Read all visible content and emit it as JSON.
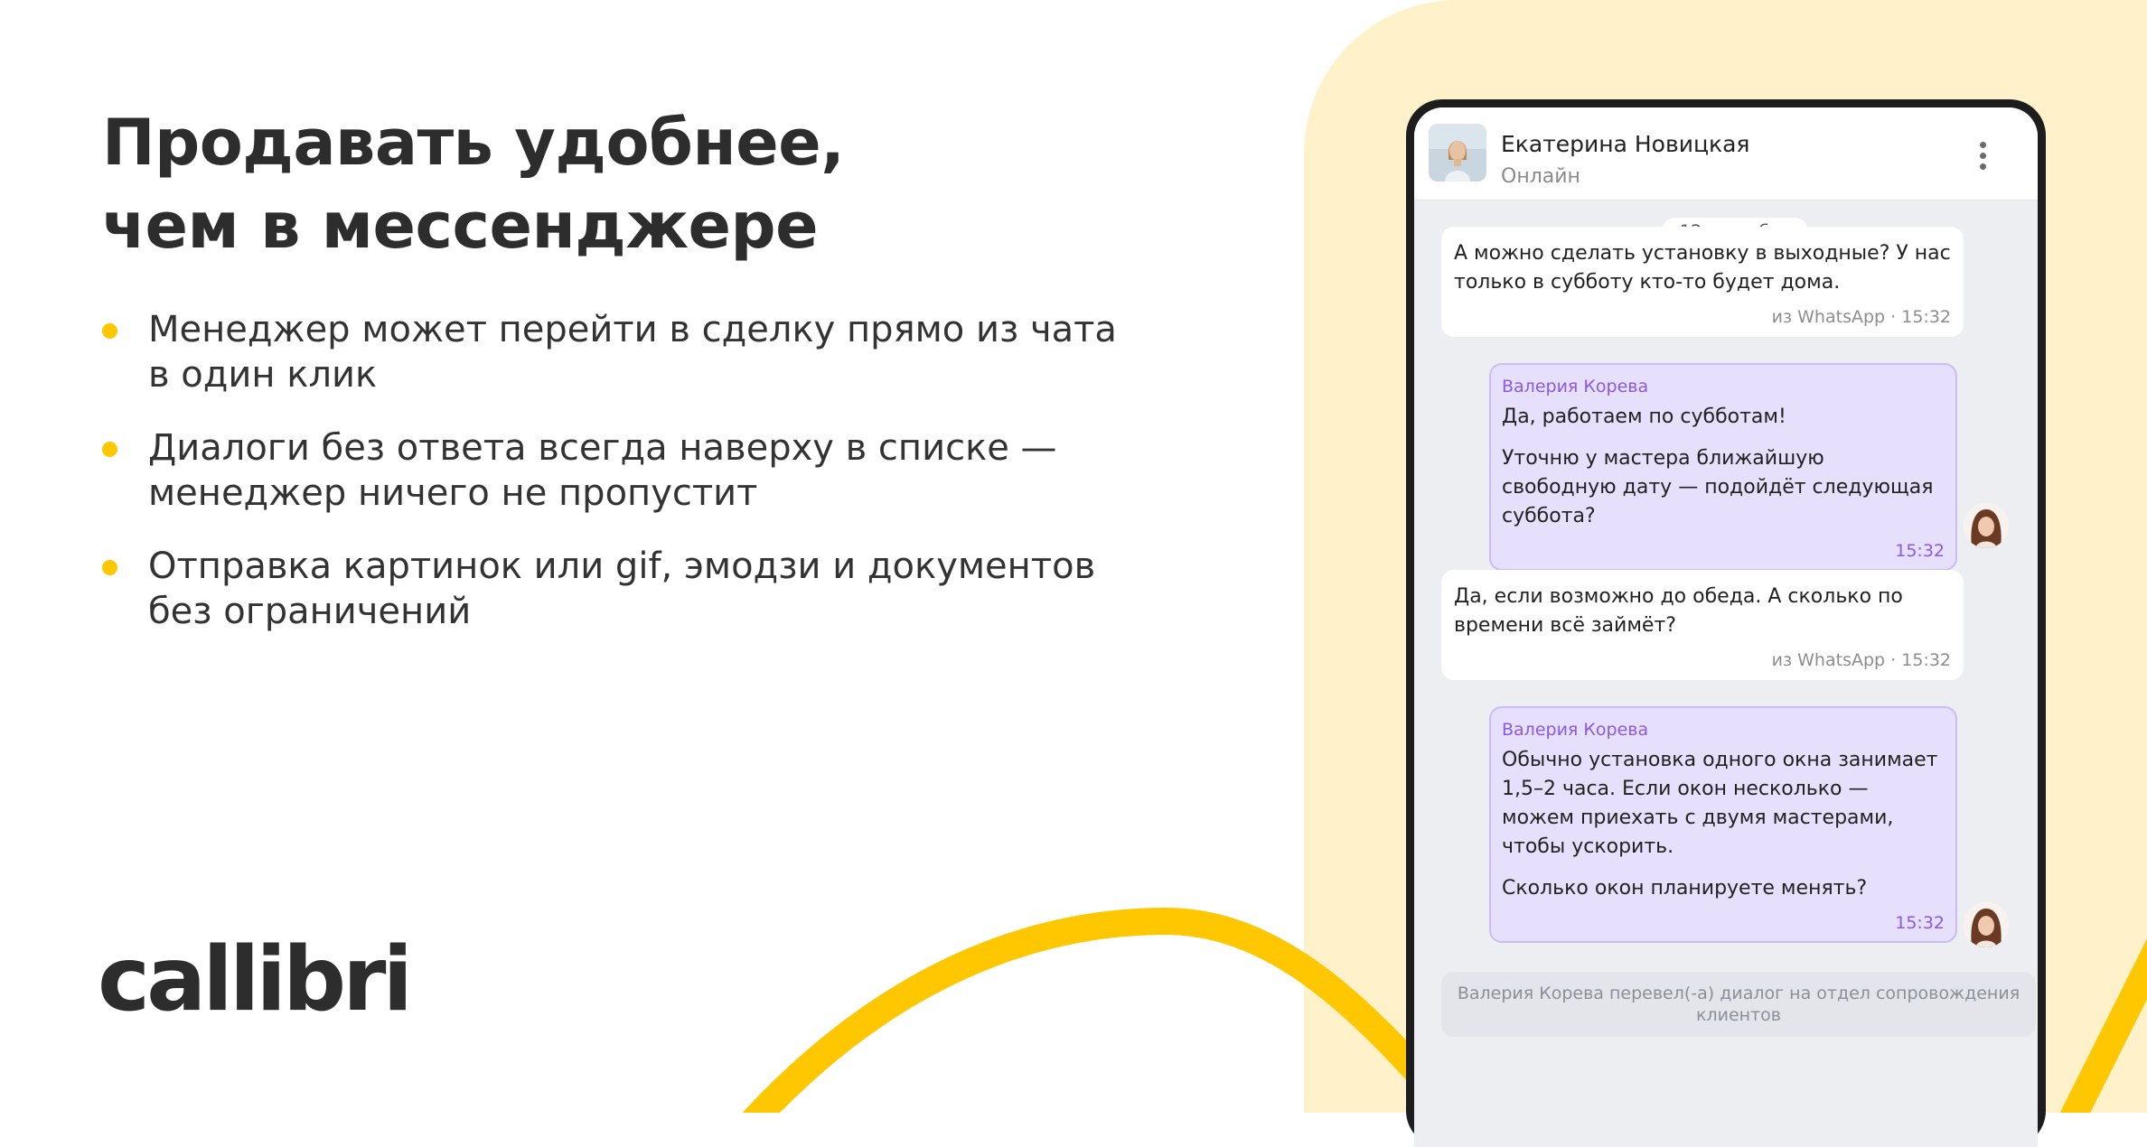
{
  "headline": {
    "line1": "Продавать удобнее,",
    "line2": "чем в мессенджере"
  },
  "bullets": [
    {
      "lines": [
        "Менеджер может перейти в сделку прямо из чата",
        "в один клик"
      ]
    },
    {
      "lines": [
        "Диалоги без ответа всегда наверху в списке —",
        "менеджер ничего не пропустит"
      ]
    },
    {
      "lines": [
        "Отправка картинок или gif, эмодзи и документов",
        "без ограничений"
      ]
    }
  ],
  "logo": {
    "text": "callibri"
  },
  "colors": {
    "accent_yellow": "#ffc700",
    "cream_bg": "#fff1c9",
    "agent_bubble": "#e7e0fc",
    "agent_name": "#8a5ae0"
  },
  "chat": {
    "contact": {
      "name": "Екатерина Новицкая",
      "status": "Онлайн"
    },
    "date": "12 сентября",
    "messages": [
      {
        "direction": "in",
        "paragraphs": [
          "А можно сделать установку в выходные? У нас только в субботу кто-то будет дома."
        ],
        "source": "из WhatsApp",
        "time": "15:32"
      },
      {
        "direction": "out",
        "sender": "Валерия Корева",
        "paragraphs": [
          "Да, работаем по субботам!",
          "Уточню у мастера ближайшую свободную дату — подойдёт следующая суббота?"
        ],
        "time": "15:32"
      },
      {
        "direction": "in",
        "paragraphs": [
          "Да, если возможно до обеда. А сколько по времени всё займёт?"
        ],
        "source": "из WhatsApp",
        "time": "15:32"
      },
      {
        "direction": "out",
        "sender": "Валерия Корева",
        "paragraphs": [
          "Обычно установка одного окна занимает 1,5–2 часа. Если окон несколько — можем приехать с двумя мастерами, чтобы ускорить.",
          "Сколько окон планируете менять?"
        ],
        "time": "15:32"
      }
    ],
    "system_note": "Валерия Корева перевел(-а) диалог на отдел сопровождения клиентов"
  }
}
